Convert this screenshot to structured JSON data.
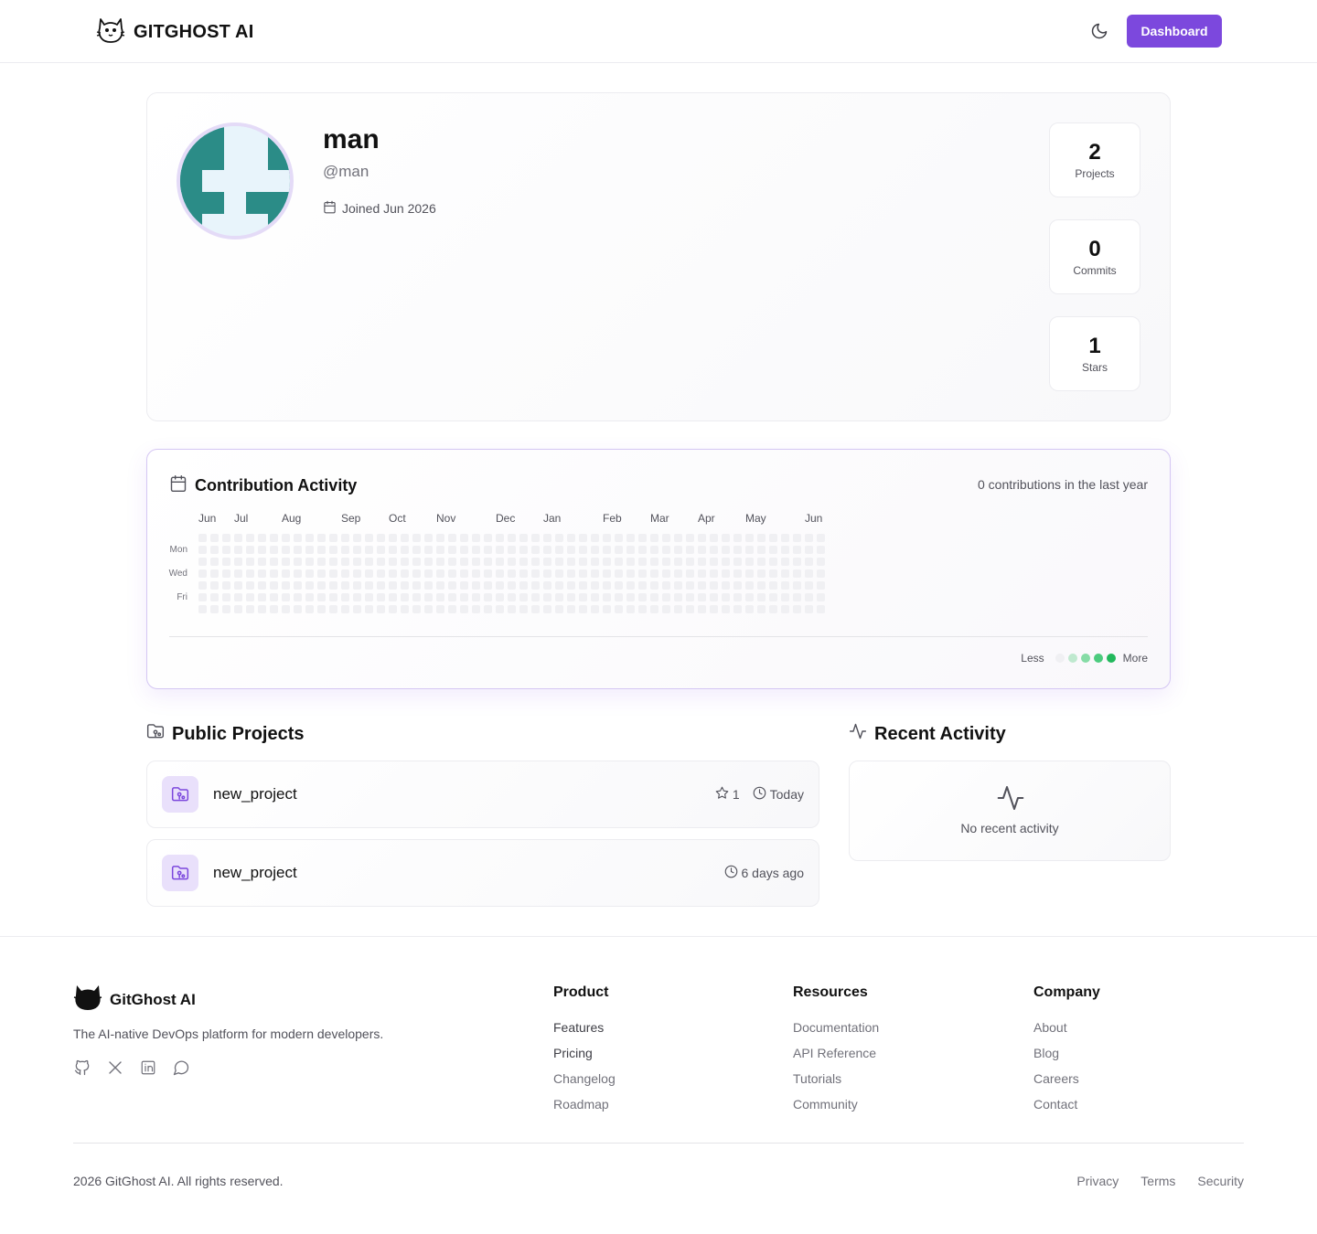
{
  "header": {
    "brand": "GITGHOST AI",
    "dashboard_label": "Dashboard"
  },
  "profile": {
    "name": "man",
    "handle": "@man",
    "joined": "Joined Jun 2026",
    "stats": [
      {
        "value": "2",
        "label": "Projects"
      },
      {
        "value": "0",
        "label": "Commits"
      },
      {
        "value": "1",
        "label": "Stars"
      }
    ]
  },
  "contributions": {
    "title": "Contribution Activity",
    "summary": "0 contributions in the last year",
    "months": [
      "Jun",
      "Jul",
      "Aug",
      "Sep",
      "Oct",
      "Nov",
      "Dec",
      "Jan",
      "Feb",
      "Mar",
      "Apr",
      "May",
      "Jun"
    ],
    "days": [
      "Mon",
      "Wed",
      "Fri"
    ],
    "legend_less": "Less",
    "legend_more": "More",
    "legend_colors": [
      "#f0f0f3",
      "#bfe9cf",
      "#86dca6",
      "#4ccb7e",
      "#22b85c"
    ]
  },
  "projects": {
    "title": "Public Projects",
    "items": [
      {
        "name": "new_project",
        "stars": "1",
        "updated": "Today"
      },
      {
        "name": "new_project",
        "stars": "",
        "updated": "6 days ago"
      }
    ]
  },
  "activity": {
    "title": "Recent Activity",
    "empty": "No recent activity"
  },
  "footer": {
    "brand": "GitGhost AI",
    "tagline": "The AI-native DevOps platform for modern developers.",
    "social_icons": [
      "github-icon",
      "x-icon",
      "linkedin-icon",
      "chat-icon"
    ],
    "columns": [
      {
        "title": "Product",
        "links": [
          "Features",
          "Pricing",
          "Changelog",
          "Roadmap"
        ]
      },
      {
        "title": "Resources",
        "links": [
          "Documentation",
          "API Reference",
          "Tutorials",
          "Community"
        ]
      },
      {
        "title": "Company",
        "links": [
          "About",
          "Blog",
          "Careers",
          "Contact"
        ]
      }
    ],
    "copyright": "2026 GitGhost AI. All rights reserved.",
    "legal": [
      "Privacy",
      "Terms",
      "Security"
    ]
  },
  "colors": {
    "accent": "#7c48dd",
    "avatar_primary": "#2b8c87",
    "avatar_bg": "#e8f4fb"
  }
}
